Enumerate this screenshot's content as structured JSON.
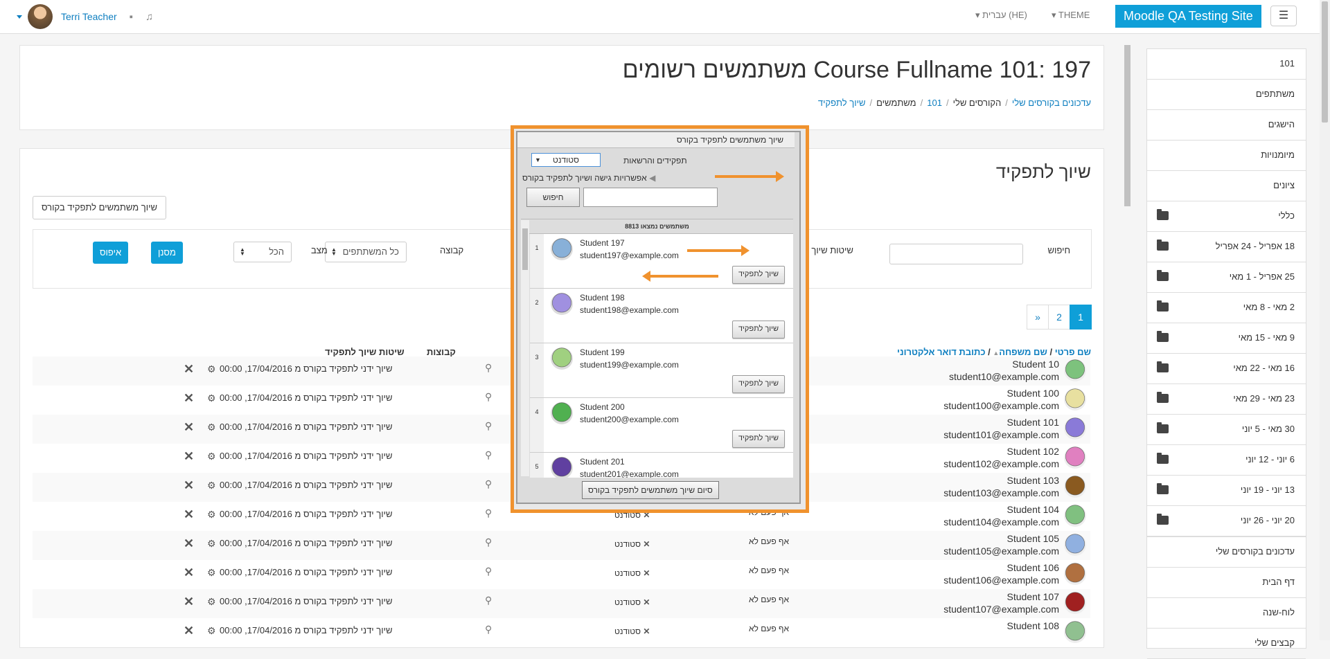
{
  "navbar": {
    "user_name": "Terri Teacher",
    "theme_label": "THEME",
    "language_label": "עברית (HE)",
    "site_name": "Moodle QA Testing Site",
    "menu_icon": "hamburger-icon",
    "message_icon": "chat-bubble-icon",
    "notification_icon": "bell-icon"
  },
  "header": {
    "title": "Course Fullname 101: 197 משתמשים רשומים",
    "breadcrumb": [
      "עדכונים בקורסים שלי",
      "הקורסים שלי",
      "101",
      "משתמשים",
      "שיוך לתפקיד"
    ]
  },
  "main": {
    "section_title": "שיוך לתפקיד",
    "enrol_button": "שיוך משתמשים לתפקיד בקורס",
    "filters": {
      "search_label": "חיפוש",
      "method_label": "שיטות שיוך לתפקיד",
      "group_label": "קבוצה",
      "group_value": "כל המשתתפים",
      "status_label": "מצב",
      "status_value": "הכל",
      "filter_button": "מסנן",
      "reset_button": "איפוס"
    },
    "pager": [
      "»",
      "2",
      "1"
    ],
    "columns": {
      "first_name": "שם פרטי",
      "last_name": "שם משפחה",
      "email": "כתובת דואר אלקטרוני",
      "groups": "קבוצות",
      "methods": "שיטות שיוך לתפקיד"
    },
    "rows": [
      {
        "name": "Student 10",
        "email": "student10@example.com",
        "role": "סטודנט",
        "last_access": "אף פעם לא",
        "method": "שיוך ידני לתפקיד בקורס מ 17/04/2016, 00:00",
        "color": "#7dc27d"
      },
      {
        "name": "Student 100",
        "email": "student100@example.com",
        "role": "סטודנט",
        "last_access": "אף פעם לא",
        "method": "שיוך ידני לתפקיד בקורס מ 17/04/2016, 00:00",
        "color": "#e8e0a0"
      },
      {
        "name": "Student 101",
        "email": "student101@example.com",
        "role": "סטודנט",
        "last_access": "אף פעם לא",
        "method": "שיוך ידני לתפקיד בקורס מ 17/04/2016, 00:00",
        "color": "#8a7ad8"
      },
      {
        "name": "Student 102",
        "email": "student102@example.com",
        "role": "סטודנט",
        "last_access": "אף פעם לא",
        "method": "שיוך ידני לתפקיד בקורס מ 17/04/2016, 00:00",
        "color": "#e080c0"
      },
      {
        "name": "Student 103",
        "email": "student103@example.com",
        "role": "סטודנט",
        "last_access": "אף פעם לא",
        "method": "שיוך ידני לתפקיד בקורס מ 17/04/2016, 00:00",
        "color": "#8a5a20"
      },
      {
        "name": "Student 104",
        "email": "student104@example.com",
        "role": "סטודנט",
        "last_access": "אף פעם לא",
        "method": "שיוך ידני לתפקיד בקורס מ 17/04/2016, 00:00",
        "color": "#80c080"
      },
      {
        "name": "Student 105",
        "email": "student105@example.com",
        "role": "סטודנט",
        "last_access": "אף פעם לא",
        "method": "שיוך ידני לתפקיד בקורס מ 17/04/2016, 00:00",
        "color": "#90b0e0"
      },
      {
        "name": "Student 106",
        "email": "student106@example.com",
        "role": "סטודנט",
        "last_access": "אף פעם לא",
        "method": "שיוך ידני לתפקיד בקורס מ 17/04/2016, 00:00",
        "color": "#b07040"
      },
      {
        "name": "Student 107",
        "email": "student107@example.com",
        "role": "סטודנט",
        "last_access": "אף פעם לא",
        "method": "שיוך ידני לתפקיד בקורס מ 17/04/2016, 00:00",
        "color": "#a02020"
      },
      {
        "name": "Student 108",
        "email": "",
        "role": "סטודנט",
        "last_access": "אף פעם לא",
        "method": "שיוך ידני לתפקיד בקורס מ 17/04/2016, 00:00",
        "color": "#90c090"
      }
    ]
  },
  "sidebar": {
    "nav_items": [
      "101",
      "משתתפים",
      "הישגים",
      "מיומנויות",
      "ציונים"
    ],
    "sections": [
      "כללי",
      "18 אפריל - 24 אפריל",
      "25 אפריל - 1 מאי",
      "2 מאי - 8 מאי",
      "9 מאי - 15 מאי",
      "16 מאי - 22 מאי",
      "23 מאי - 29 מאי",
      "30 מאי - 5 יוני",
      "6 יוני - 12 יוני",
      "13 יוני - 19 יוני",
      "20 יוני - 26 יוני"
    ],
    "bottom_items": [
      "עדכונים בקורסים שלי",
      "דף הבית",
      "לוח-שנה",
      "קבצים שלי"
    ]
  },
  "popup": {
    "title": "שיוך משתמשים לתפקיד בקורס",
    "roles_label": "תפקידים והרשאות",
    "role_select": "סטודנט",
    "options_label": "אפשרויות גישה ושיוך לתפקיד בקורס",
    "search_button": "חיפוש",
    "found_count": "8813 משתמשים נמצאו",
    "assign_button": "שיוך לתפקיד",
    "finish_button": "סיום שיוך משתמשים לתפקיד בקורס",
    "users": [
      {
        "num": "1",
        "name": "Student 197",
        "email": "student197@example.com",
        "color": "#88b0d8"
      },
      {
        "num": "2",
        "name": "Student 198",
        "email": "student198@example.com",
        "color": "#a090e0"
      },
      {
        "num": "3",
        "name": "Student 199",
        "email": "student199@example.com",
        "color": "#a0d080"
      },
      {
        "num": "4",
        "name": "Student 200",
        "email": "student200@example.com",
        "color": "#50b050"
      },
      {
        "num": "5",
        "name": "Student 201",
        "email": "student201@example.com",
        "color": "#6040a0"
      }
    ]
  }
}
